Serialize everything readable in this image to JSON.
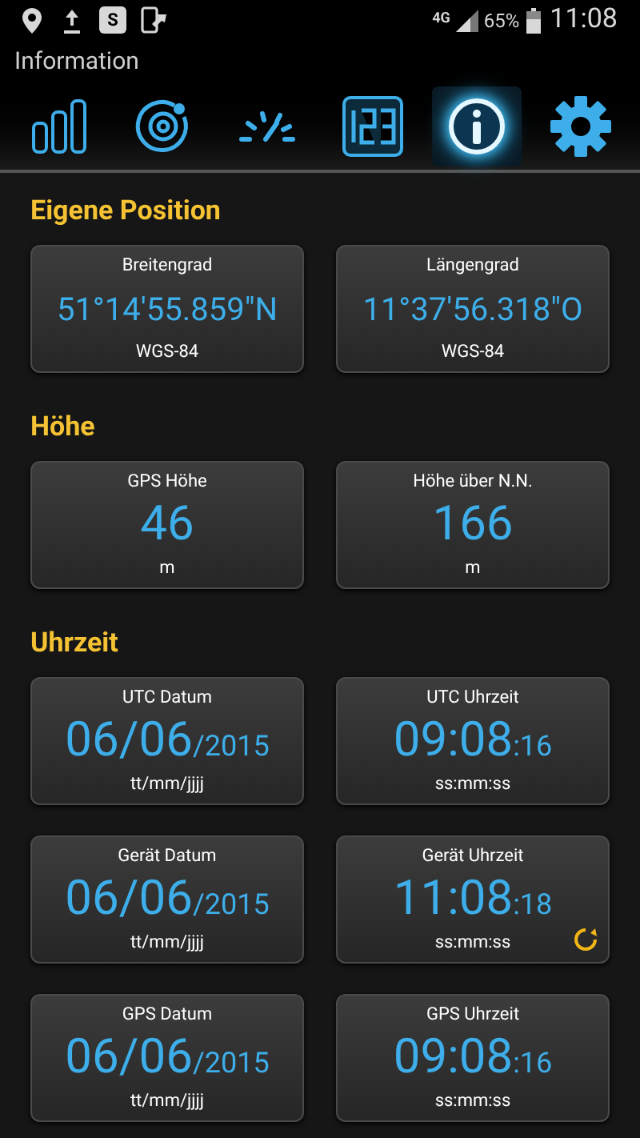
{
  "status_bar": {
    "app_badge": "S",
    "network": "4G",
    "battery": "65%",
    "time": "11:08"
  },
  "window": {
    "title": "Information"
  },
  "tabs": [
    {
      "kind": "bars",
      "selected": false
    },
    {
      "kind": "orbit",
      "selected": false
    },
    {
      "kind": "gauge",
      "selected": false
    },
    {
      "kind": "digits",
      "selected": false
    },
    {
      "kind": "info",
      "selected": true
    },
    {
      "kind": "gear",
      "selected": false
    }
  ],
  "sections": [
    {
      "title": "Eigene Position",
      "cards": [
        {
          "label": "Breitengrad",
          "value": "51°14'55.859\"N",
          "unit": "WGS-84",
          "kind": "coordinate",
          "refresh": false
        },
        {
          "label": "Längengrad",
          "value": "11°37'56.318\"O",
          "unit": "WGS-84",
          "kind": "coordinate",
          "refresh": false
        }
      ]
    },
    {
      "title": "Höhe",
      "cards": [
        {
          "label": "GPS Höhe",
          "value": "46",
          "unit": "m",
          "kind": "number",
          "refresh": false
        },
        {
          "label": "Höhe über N.N.",
          "value": "166",
          "unit": "m",
          "kind": "number",
          "refresh": false
        }
      ]
    },
    {
      "title": "Uhrzeit",
      "cards": [
        {
          "label": "UTC Datum",
          "value": "06/06",
          "value_suffix": "/2015",
          "unit": "tt/mm/jjjj",
          "kind": "number",
          "refresh": false
        },
        {
          "label": "UTC Uhrzeit",
          "value": "09:08",
          "value_suffix": ":16",
          "unit": "ss:mm:ss",
          "kind": "number",
          "refresh": false
        },
        {
          "label": "Gerät Datum",
          "value": "06/06",
          "value_suffix": "/2015",
          "unit": "tt/mm/jjjj",
          "kind": "number",
          "refresh": false
        },
        {
          "label": "Gerät Uhrzeit",
          "value": "11:08",
          "value_suffix": ":18",
          "unit": "ss:mm:ss",
          "kind": "number",
          "refresh": true
        },
        {
          "label": "GPS Datum",
          "value": "06/06",
          "value_suffix": "/2015",
          "unit": "tt/mm/jjjj",
          "kind": "number",
          "refresh": false
        },
        {
          "label": "GPS Uhrzeit",
          "value": "09:08",
          "value_suffix": ":16",
          "unit": "ss:mm:ss",
          "kind": "number",
          "refresh": false
        }
      ]
    }
  ]
}
